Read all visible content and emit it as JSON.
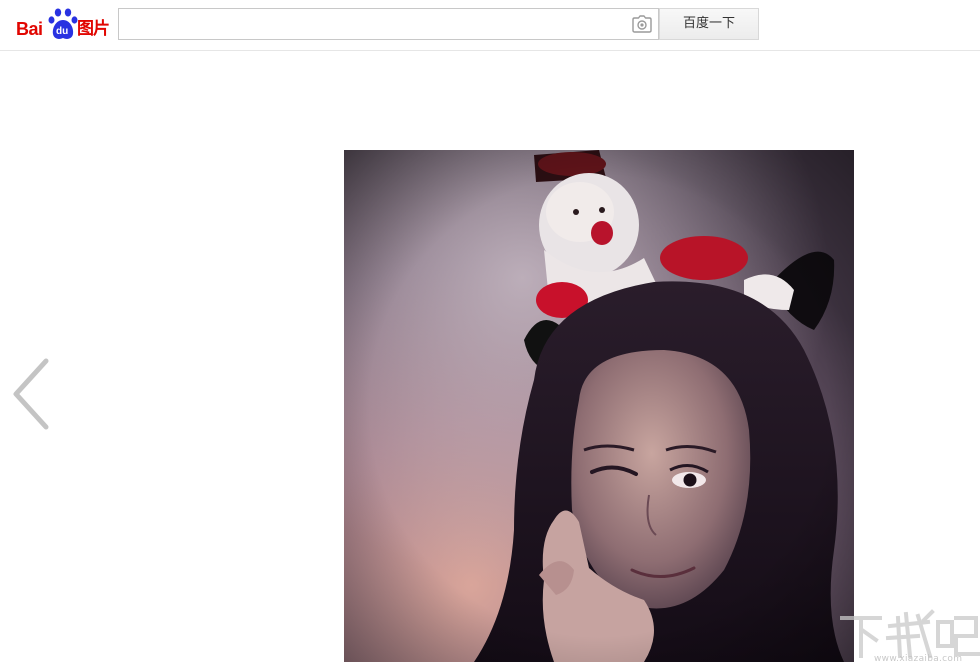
{
  "header": {
    "logo": {
      "text_bai": "Bai",
      "text_du": "du",
      "text_tupian": "图片",
      "brand_color": "#e10601",
      "paw_color": "#2932e1"
    },
    "search": {
      "value": "",
      "placeholder": "",
      "camera_icon": "camera-icon"
    },
    "search_button_label": "百度一下"
  },
  "viewer": {
    "prev_arrow_icon": "chevron-left-icon",
    "photo_description_icon": "photo"
  },
  "watermark": {
    "logo_text": "下载吧",
    "url": "www.xiazaiba.com"
  }
}
